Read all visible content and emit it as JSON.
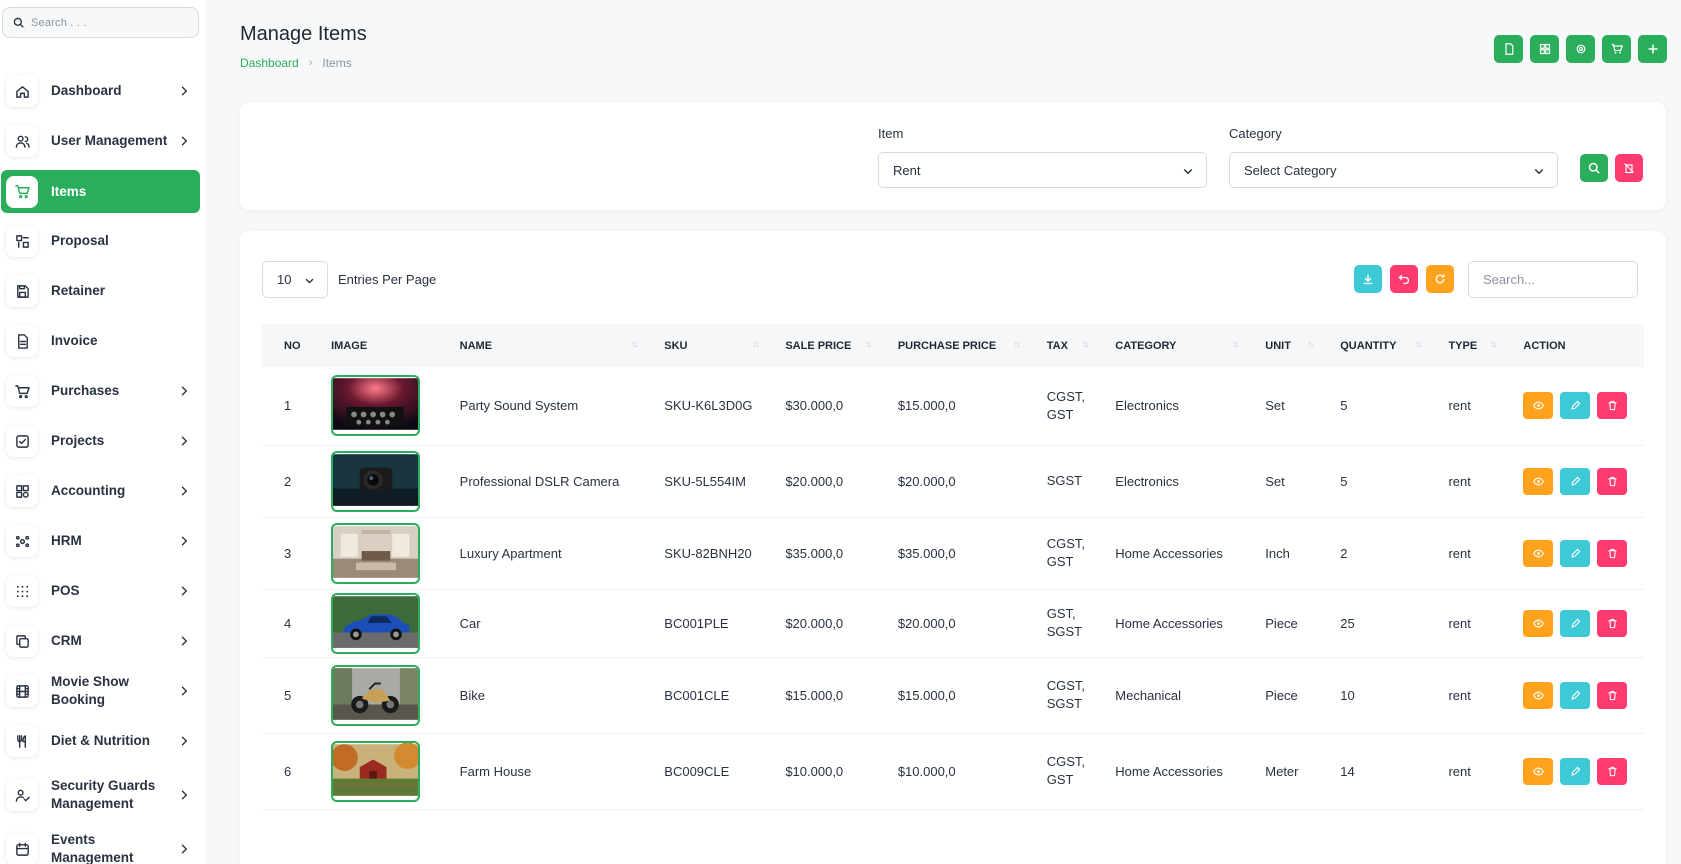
{
  "sidebar": {
    "search_placeholder": "Search . . .",
    "items": [
      {
        "label": "Dashboard",
        "icon": "home-icon",
        "chevron": true
      },
      {
        "label": "User Management",
        "icon": "users-icon",
        "chevron": true
      },
      {
        "label": "Items",
        "icon": "cart-icon",
        "chevron": false,
        "active": true
      },
      {
        "label": "Proposal",
        "icon": "proposal-icon",
        "chevron": false
      },
      {
        "label": "Retainer",
        "icon": "floppy-icon",
        "chevron": false
      },
      {
        "label": "Invoice",
        "icon": "file-icon",
        "chevron": false
      },
      {
        "label": "Purchases",
        "icon": "shopping-cart-icon",
        "chevron": true
      },
      {
        "label": "Projects",
        "icon": "checkbox-icon",
        "chevron": true
      },
      {
        "label": "Accounting",
        "icon": "layout-icon",
        "chevron": true
      },
      {
        "label": "HRM",
        "icon": "network-icon",
        "chevron": true
      },
      {
        "label": "POS",
        "icon": "grid-dots-icon",
        "chevron": true
      },
      {
        "label": "CRM",
        "icon": "copy-icon",
        "chevron": true
      },
      {
        "label": "Movie Show Booking",
        "icon": "film-icon",
        "chevron": true
      },
      {
        "label": "Diet & Nutrition",
        "icon": "utensils-icon",
        "chevron": true
      },
      {
        "label": "Security Guards Management",
        "icon": "user-check-icon",
        "chevron": true
      },
      {
        "label": "Events Management",
        "icon": "calendar-icon",
        "chevron": true
      }
    ]
  },
  "header": {
    "title": "Manage Items",
    "breadcrumb": {
      "home": "Dashboard",
      "current": "Items"
    }
  },
  "filters": {
    "item_label": "Item",
    "item_value": "Rent",
    "category_label": "Category",
    "category_value": "Select Category"
  },
  "table_controls": {
    "entries_value": "10",
    "entries_label": "Entries Per Page",
    "search_placeholder": "Search..."
  },
  "table": {
    "columns": [
      "NO",
      "IMAGE",
      "NAME",
      "SKU",
      "SALE PRICE",
      "PURCHASE PRICE",
      "TAX",
      "CATEGORY",
      "UNIT",
      "QUANTITY",
      "TYPE",
      "ACTION"
    ],
    "rows": [
      {
        "no": "1",
        "name": "Party Sound System",
        "sku": "SKU-K6L3D0G",
        "sale": "$30.000,0",
        "purchase": "$15.000,0",
        "tax": [
          "CGST,",
          "GST"
        ],
        "category": "Electronics",
        "unit": "Set",
        "qty": "5",
        "type": "rent"
      },
      {
        "no": "2",
        "name": "Professional DSLR Camera",
        "sku": "SKU-5L554IM",
        "sale": "$20.000,0",
        "purchase": "$20.000,0",
        "tax": [
          "SGST"
        ],
        "category": "Electronics",
        "unit": "Set",
        "qty": "5",
        "type": "rent"
      },
      {
        "no": "3",
        "name": "Luxury Apartment",
        "sku": "SKU-82BNH20",
        "sale": "$35.000,0",
        "purchase": "$35.000,0",
        "tax": [
          "CGST,",
          "GST"
        ],
        "category": "Home Accessories",
        "unit": "Inch",
        "qty": "2",
        "type": "rent"
      },
      {
        "no": "4",
        "name": "Car",
        "sku": "BC001PLE",
        "sale": "$20.000,0",
        "purchase": "$20.000,0",
        "tax": [
          "GST,",
          "SGST"
        ],
        "category": "Home Accessories",
        "unit": "Piece",
        "qty": "25",
        "type": "rent"
      },
      {
        "no": "5",
        "name": "Bike",
        "sku": "BC001CLE",
        "sale": "$15.000,0",
        "purchase": "$15.000,0",
        "tax": [
          "CGST,",
          "SGST"
        ],
        "category": "Mechanical",
        "unit": "Piece",
        "qty": "10",
        "type": "rent"
      },
      {
        "no": "6",
        "name": "Farm House",
        "sku": "BC009CLE",
        "sale": "$10.000,0",
        "purchase": "$10.000,0",
        "tax": [
          "CGST,",
          "GST"
        ],
        "category": "Home Accessories",
        "unit": "Meter",
        "qty": "14",
        "type": "rent"
      }
    ]
  },
  "colors": {
    "brand": "#2bae5c",
    "orange": "#ffa21d",
    "cyan": "#3ec9d6",
    "pink": "#ff3a6e"
  }
}
